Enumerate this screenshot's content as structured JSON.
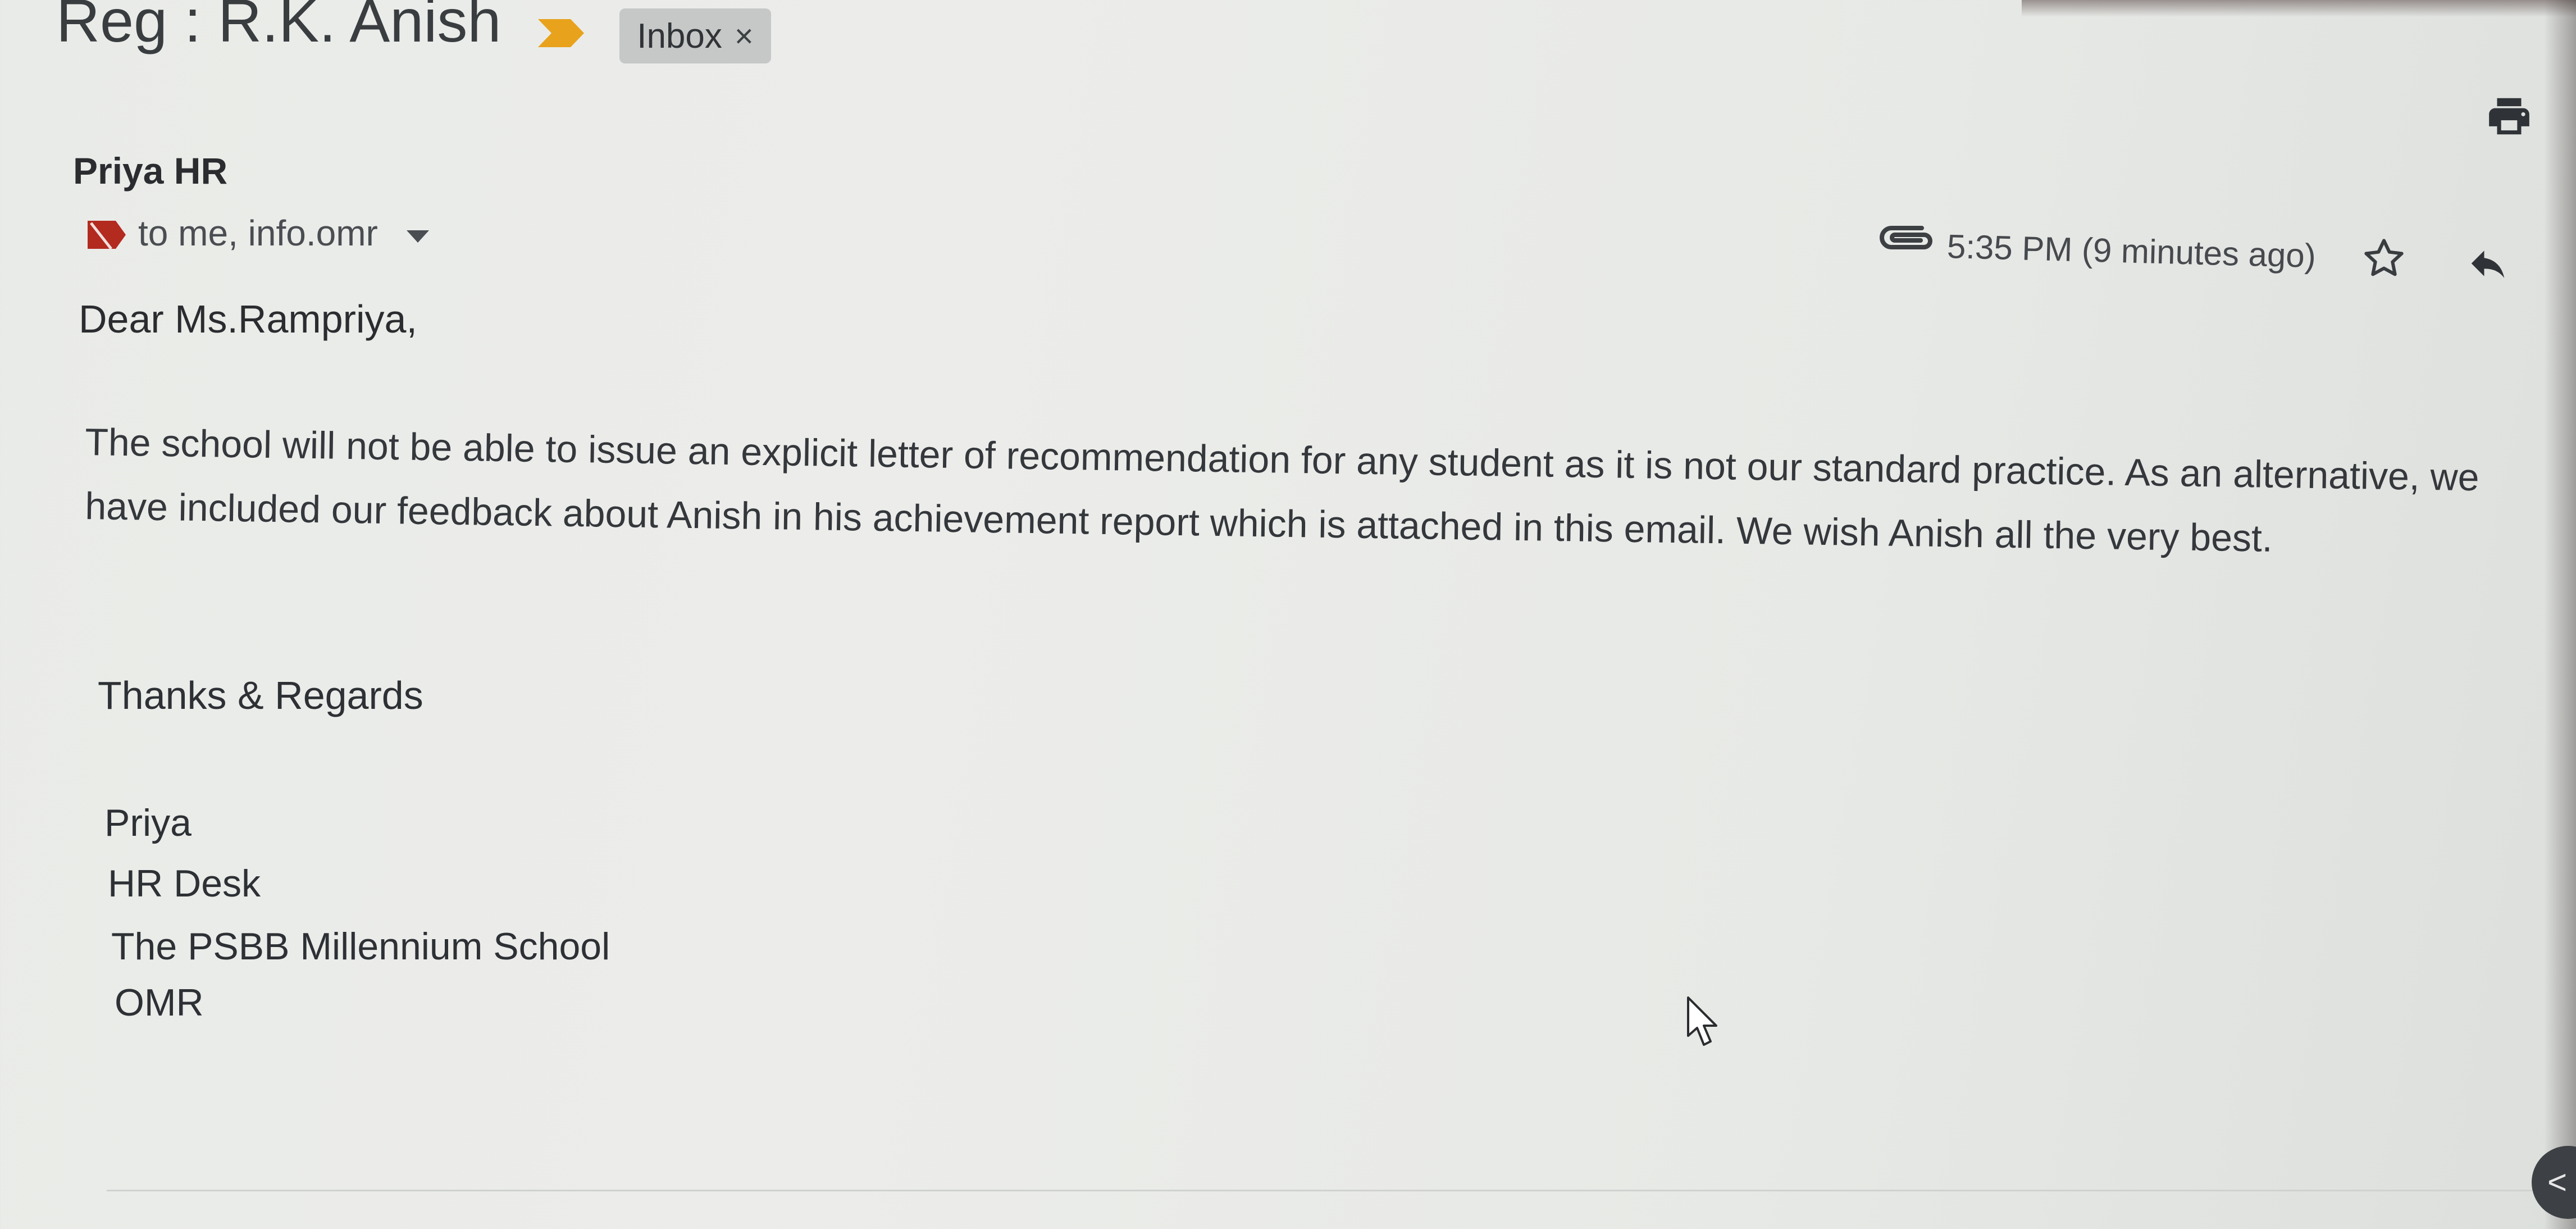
{
  "email": {
    "subject": "Reg : R.K. Anish",
    "label_chip": {
      "text": "Inbox",
      "close": "×"
    },
    "sender": "Priya HR",
    "recipients": "to me, info.omr",
    "timestamp": "5:35 PM (9 minutes ago)",
    "greeting": "Dear Ms.Rampriya,",
    "body": [
      "The school will not be able to issue an explicit letter of recommendation for any student as it is not our standard practice. As an alternative, we",
      "have included our feedback about Anish in his achievement report which is attached in this email. We wish Anish all the very best."
    ],
    "signoff": "Thanks & Regards",
    "signature": [
      "Priya",
      "HR Desk",
      "The PSBB Millennium School",
      "OMR"
    ]
  },
  "colors": {
    "importance_marker": "#e8a21c",
    "label_marker": "#b32a1f",
    "chip_background": "#c5c8c6"
  },
  "icons": {
    "importance": "importance-marker-icon",
    "label": "label-tag-icon",
    "dropdown": "chevron-down-icon",
    "attachment": "paperclip-icon",
    "star": "star-icon",
    "reply": "reply-icon",
    "print": "print-icon",
    "collapse": "chevron-left-icon",
    "collapse_glyph": "<"
  }
}
